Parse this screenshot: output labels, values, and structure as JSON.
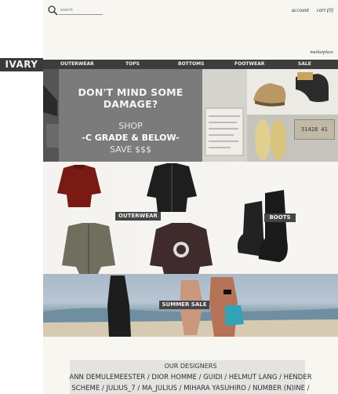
{
  "header": {
    "search_placeholder": "search",
    "links": {
      "account": "account",
      "cart": "cart (0)"
    },
    "marketplace": "marketplace"
  },
  "logo": "IVARY",
  "nav": {
    "items": [
      "OUTERWEAR",
      "TOPS",
      "BOTTOMS",
      "FOOTWEAR",
      "SALE"
    ]
  },
  "hero": {
    "title": "DON'T MIND SOME DAMAGE?",
    "shop": "SHOP",
    "grade": "-C GRADE & BELOW-",
    "save": "SAVE $$$",
    "tag_number": "51428 41"
  },
  "grid": {
    "outerwear": "OUTERWEAR",
    "boots": "BOOTS"
  },
  "summer": {
    "label": "SUMMER SALE"
  },
  "designers": {
    "title": "OUR DESIGNERS",
    "line1": "ANN DEMULEMEESTER / DIOR HOMME / GUIDI / HELMUT LANG / HENDER",
    "line2": "SCHEME / JULIUS_7 / MA_JULIUS / MIHARA YASUHIRO / NUMBER (N)INE /"
  },
  "colors": {
    "nav_bg": "#3d3d3d",
    "promo_bg": "#7b7b7b",
    "page_bg": "#f7f6f0",
    "label_bg": "#454545"
  }
}
